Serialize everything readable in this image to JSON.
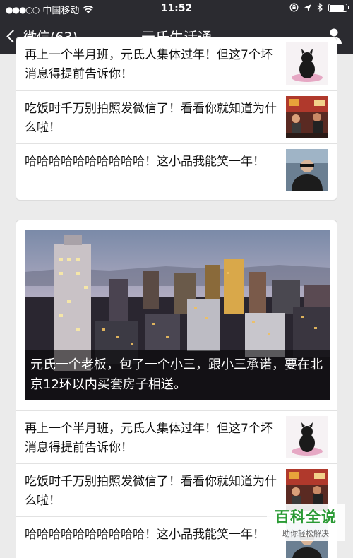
{
  "status_bar": {
    "carrier": "中国移动",
    "time": "11:52"
  },
  "nav": {
    "back_label": "微信(63)",
    "title": "元氏生活通"
  },
  "card1": {
    "items": [
      {
        "text": "再上一个半月班，元氏人集体过年！但这7个坏消息得提前告诉你！"
      },
      {
        "text": "吃饭时千万别拍照发微信了！看看你就知道为什么啦！"
      },
      {
        "text": "哈哈哈哈哈哈哈哈哈哈！这小品我能笑一年！"
      }
    ]
  },
  "card2": {
    "hero_caption": "元氏一个老板，包了一个小三，跟小三承诺，要在北京12环以内买套房子相送。",
    "items": [
      {
        "text": "再上一个半月班，元氏人集体过年！但这7个坏消息得提前告诉你！"
      },
      {
        "text": "吃饭时千万别拍照发微信了！看看你就知道为什么啦！"
      },
      {
        "text": "哈哈哈哈哈哈哈哈哈哈！这小品我能笑一年！"
      }
    ]
  },
  "watermark": {
    "title": "百科全说",
    "subtitle": "助你轻松解决"
  }
}
